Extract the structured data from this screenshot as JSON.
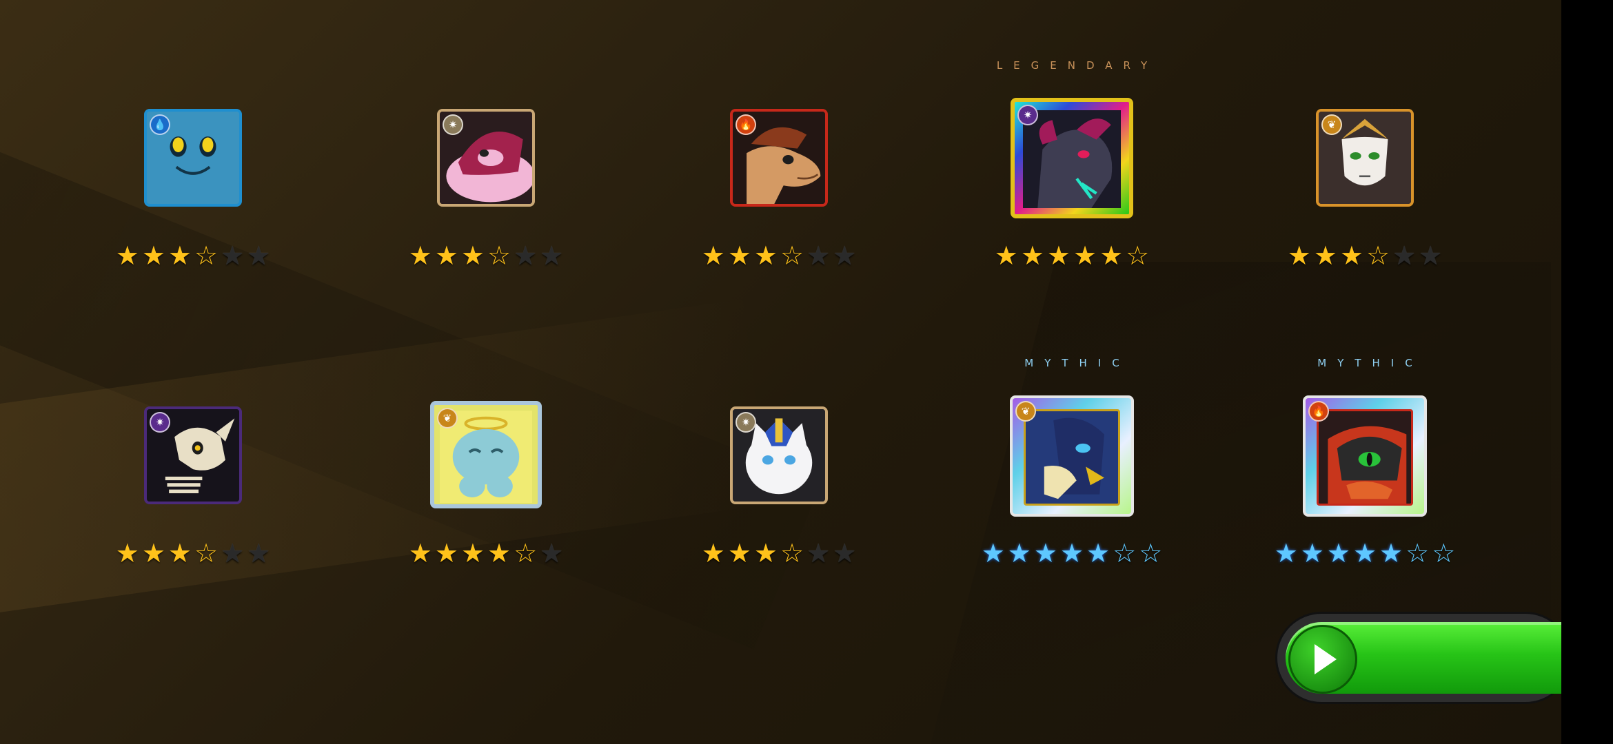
{
  "colors": {
    "star_gold": "#ffc21a",
    "star_blue": "#5ec8ff",
    "legendary_label": "#c9925a",
    "mythic_label": "#8fd0f2",
    "continue_green": "#27c417"
  },
  "rewards": [
    {
      "tier_label": "",
      "element": "water",
      "element_icon": "water-drop-icon",
      "stars": 3,
      "max_stars": 6,
      "star_color": "gold"
    },
    {
      "tier_label": "",
      "element": "light",
      "element_icon": "light-gear-icon",
      "stars": 3,
      "max_stars": 6,
      "star_color": "gold"
    },
    {
      "tier_label": "",
      "element": "fire",
      "element_icon": "flame-icon",
      "stars": 3,
      "max_stars": 6,
      "star_color": "gold"
    },
    {
      "tier_label": "LEGENDARY",
      "element": "dark",
      "element_icon": "dark-gear-icon",
      "stars": 5,
      "max_stars": 6,
      "star_color": "gold"
    },
    {
      "tier_label": "",
      "element": "nature",
      "element_icon": "leaf-icon",
      "stars": 3,
      "max_stars": 6,
      "star_color": "gold"
    },
    {
      "tier_label": "",
      "element": "dark",
      "element_icon": "dark-gear-icon",
      "stars": 3,
      "max_stars": 6,
      "star_color": "gold"
    },
    {
      "tier_label": "",
      "element": "nature",
      "element_icon": "leaf-icon",
      "stars": 4,
      "max_stars": 6,
      "star_color": "gold"
    },
    {
      "tier_label": "",
      "element": "light",
      "element_icon": "light-gear-icon",
      "stars": 3,
      "max_stars": 6,
      "star_color": "gold"
    },
    {
      "tier_label": "MYTHIC",
      "element": "nature",
      "element_icon": "leaf-icon",
      "stars": 5,
      "max_stars": 7,
      "star_color": "blue"
    },
    {
      "tier_label": "MYTHIC",
      "element": "fire",
      "element_icon": "flame-icon",
      "stars": 5,
      "max_stars": 7,
      "star_color": "blue"
    }
  ],
  "continue_button": {
    "icon": "play-arrow-icon"
  }
}
